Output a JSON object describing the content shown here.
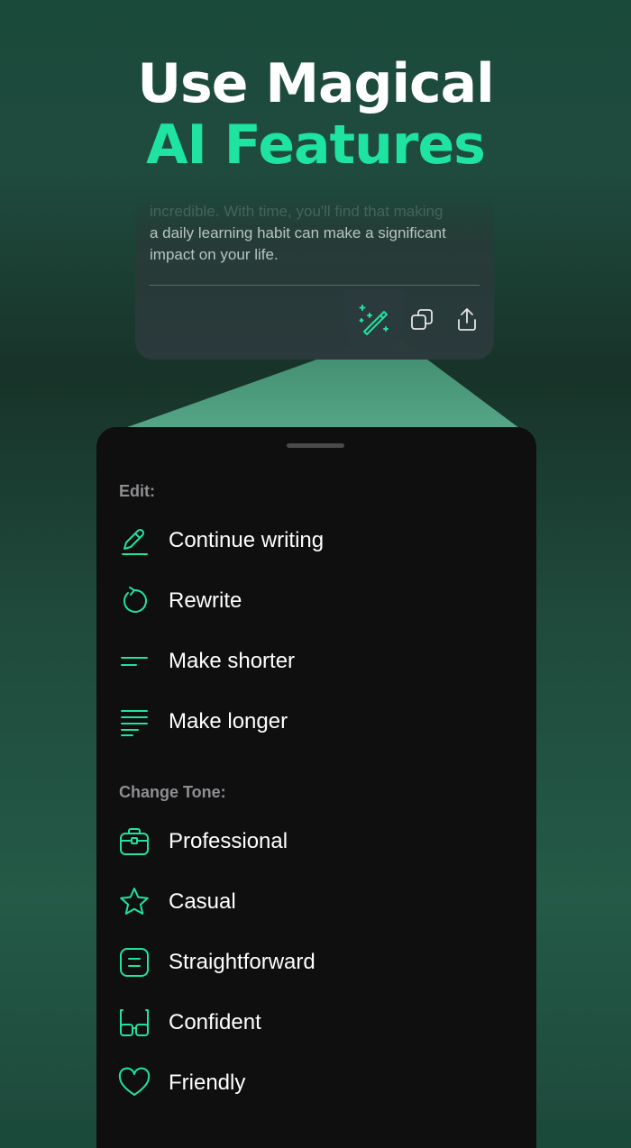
{
  "headline": {
    "line1": "Use Magical",
    "line2": "AI Features"
  },
  "editor": {
    "text_faded": "incredible. With time, you'll find that making",
    "text_line2": "a daily learning habit can make a significant",
    "text_line3": "impact on your life."
  },
  "menu": {
    "edit_label": "Edit:",
    "edit_items": [
      {
        "label": "Continue writing",
        "icon": "pencil-icon"
      },
      {
        "label": "Rewrite",
        "icon": "rotate-icon"
      },
      {
        "label": "Make shorter",
        "icon": "short-lines-icon"
      },
      {
        "label": "Make longer",
        "icon": "long-lines-icon"
      }
    ],
    "tone_label": "Change Tone:",
    "tone_items": [
      {
        "label": "Professional",
        "icon": "briefcase-icon"
      },
      {
        "label": "Casual",
        "icon": "star-icon"
      },
      {
        "label": "Straightforward",
        "icon": "list-box-icon"
      },
      {
        "label": "Confident",
        "icon": "glasses-icon"
      },
      {
        "label": "Friendly",
        "icon": "heart-icon"
      }
    ]
  },
  "colors": {
    "accent": "#1fe3a0",
    "sheet_bg": "#0f0f0f",
    "label_gray": "#8e8e93"
  }
}
